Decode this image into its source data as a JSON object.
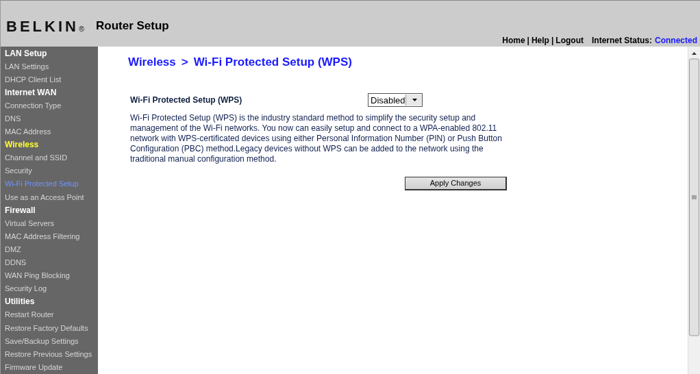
{
  "header": {
    "logo": "BELKIN",
    "logo_mark": "®",
    "title": "Router Setup",
    "nav_links": [
      "Home",
      "Help",
      "Logout"
    ],
    "nav_separator": "|",
    "status_label": "Internet Status:",
    "status_value": "Connected"
  },
  "sidebar": {
    "items": [
      {
        "label": "LAN Setup",
        "kind": "heading",
        "selected": false
      },
      {
        "label": "LAN Settings",
        "kind": "link",
        "selected": false
      },
      {
        "label": "DHCP Client List",
        "kind": "link",
        "selected": false
      },
      {
        "label": "Internet WAN",
        "kind": "heading",
        "selected": false
      },
      {
        "label": "Connection Type",
        "kind": "link",
        "selected": false
      },
      {
        "label": "DNS",
        "kind": "link",
        "selected": false
      },
      {
        "label": "MAC Address",
        "kind": "link",
        "selected": false
      },
      {
        "label": "Wireless",
        "kind": "heading",
        "selected": true
      },
      {
        "label": "Channel and SSID",
        "kind": "link",
        "selected": false
      },
      {
        "label": "Security",
        "kind": "link",
        "selected": false
      },
      {
        "label": "Wi-Fi Protected Setup",
        "kind": "link",
        "selected": true
      },
      {
        "label": "Use as an Access Point",
        "kind": "link",
        "selected": false
      },
      {
        "label": "Firewall",
        "kind": "heading",
        "selected": false
      },
      {
        "label": "Virtual Servers",
        "kind": "link",
        "selected": false
      },
      {
        "label": "MAC Address Filtering",
        "kind": "link",
        "selected": false
      },
      {
        "label": "DMZ",
        "kind": "link",
        "selected": false
      },
      {
        "label": "DDNS",
        "kind": "link",
        "selected": false
      },
      {
        "label": "WAN Ping Blocking",
        "kind": "link",
        "selected": false
      },
      {
        "label": "Security Log",
        "kind": "link",
        "selected": false
      },
      {
        "label": "Utilities",
        "kind": "heading",
        "selected": false
      },
      {
        "label": "Restart Router",
        "kind": "link",
        "selected": false
      },
      {
        "label": "Restore Factory Defaults",
        "kind": "link",
        "selected": false
      },
      {
        "label": "Save/Backup Settings",
        "kind": "link",
        "selected": false
      },
      {
        "label": "Restore Previous Settings",
        "kind": "link",
        "selected": false
      },
      {
        "label": "Firmware Update",
        "kind": "link",
        "selected": false
      }
    ]
  },
  "content": {
    "breadcrumb": [
      "Wireless",
      ">",
      "Wi-Fi Protected Setup (WPS)"
    ],
    "field": {
      "label": "Wi-Fi Protected Setup (WPS)",
      "value": "Disabled"
    },
    "description": "Wi-Fi Protected Setup (WPS) is the industry standard method to simplify the security setup and management of the Wi-Fi networks. You now can easily setup and connect to a WPA-enabled 802.11 network with WPS-certificated devices using either Personal Information Number (PIN) or Push Button Configuration (PBC) method.Legacy devices without WPS can be added to the network using the traditional manual configuration method.",
    "apply_button": "Apply Changes"
  }
}
